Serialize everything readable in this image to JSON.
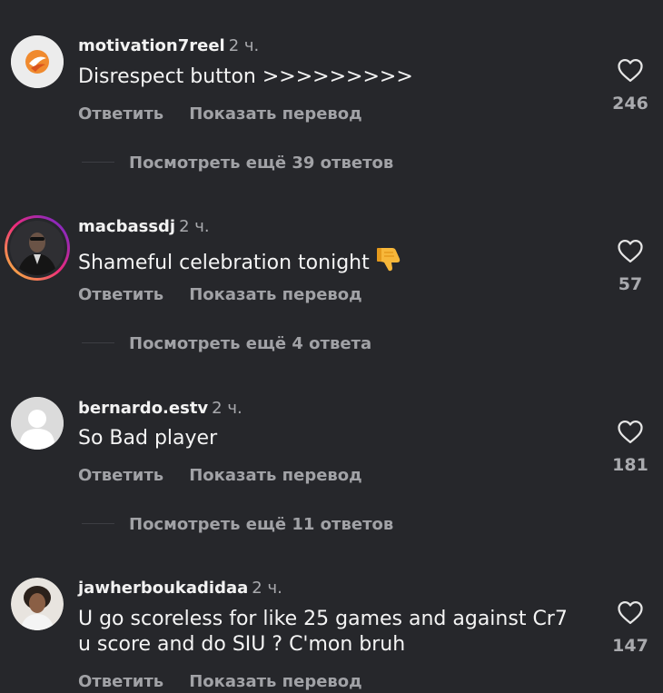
{
  "comments": [
    {
      "username": "motivation7reel",
      "time": "2 ч.",
      "text": "Disrespect button >>>>>>>>>",
      "reply_label": "Ответить",
      "translate_label": "Показать перевод",
      "likes": "246",
      "view_replies": "Посмотреть ещё 39 ответов"
    },
    {
      "username": "macbassdj",
      "time": "2 ч.",
      "text": "Shameful celebration tonight",
      "emoji": "thumbs-down-icon",
      "reply_label": "Ответить",
      "translate_label": "Показать перевод",
      "likes": "57",
      "view_replies": "Посмотреть ещё 4 ответа"
    },
    {
      "username": "bernardo.estv",
      "time": "2 ч.",
      "text": "So Bad player",
      "reply_label": "Ответить",
      "translate_label": "Показать перевод",
      "likes": "181",
      "view_replies": "Посмотреть ещё 11 ответов"
    },
    {
      "username": "jawherboukadidaa",
      "time": "2 ч.",
      "text_lines": [
        "U go scoreless for like 25 games and against Cr7",
        "u score and do SIU ? C'mon bruh"
      ],
      "reply_label": "Ответить",
      "translate_label": "Показать перевод",
      "likes": "147"
    }
  ],
  "colors": {
    "background": "#26272b",
    "primary_text": "#f4f4f4",
    "secondary_text": "#a1a2a6",
    "story_ring_start": "#f9ce34",
    "story_ring_end": "#c913b9"
  }
}
